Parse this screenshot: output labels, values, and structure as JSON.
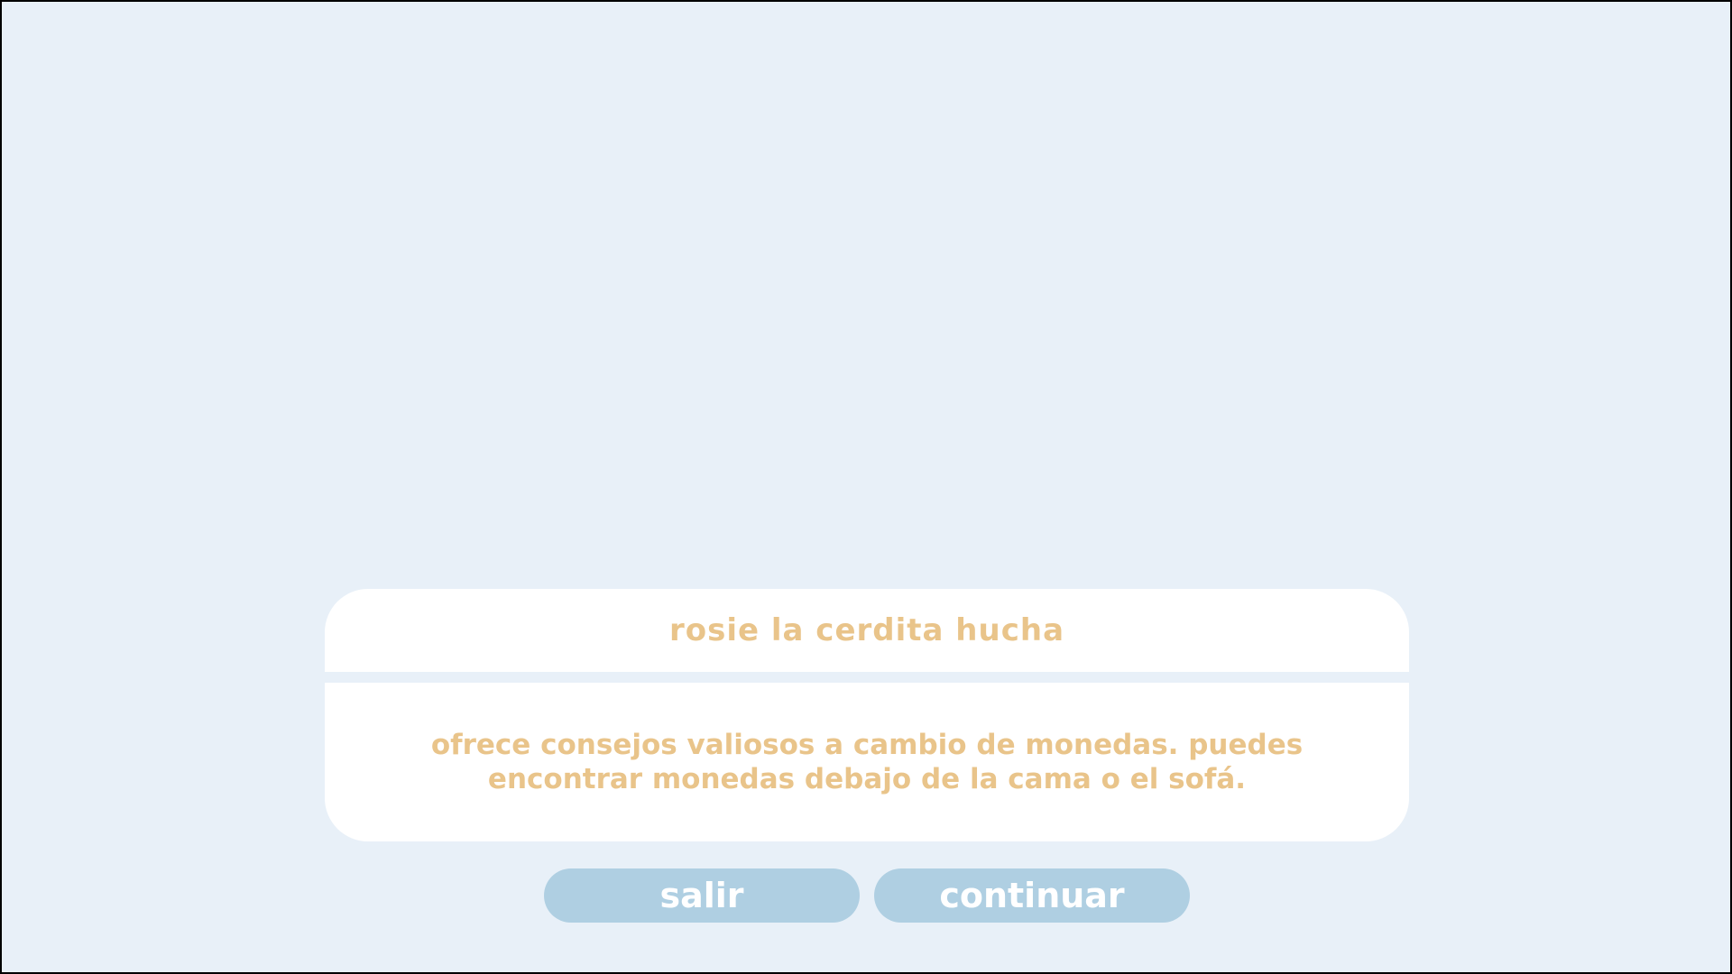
{
  "dialog": {
    "title": "Rosie la cerdita hucha",
    "text": "Ofrece consejos valiosos a cambio de monedas. Puedes encontrar monedas debajo de la cama o el sofá."
  },
  "buttons": {
    "exit_label": "salir",
    "continue_label": "continuar"
  },
  "colors": {
    "background": "#e8f0f8",
    "panel": "#ffffff",
    "text_accent": "#e9c48a",
    "button": "#afcfe2",
    "button_text": "#ffffff"
  }
}
